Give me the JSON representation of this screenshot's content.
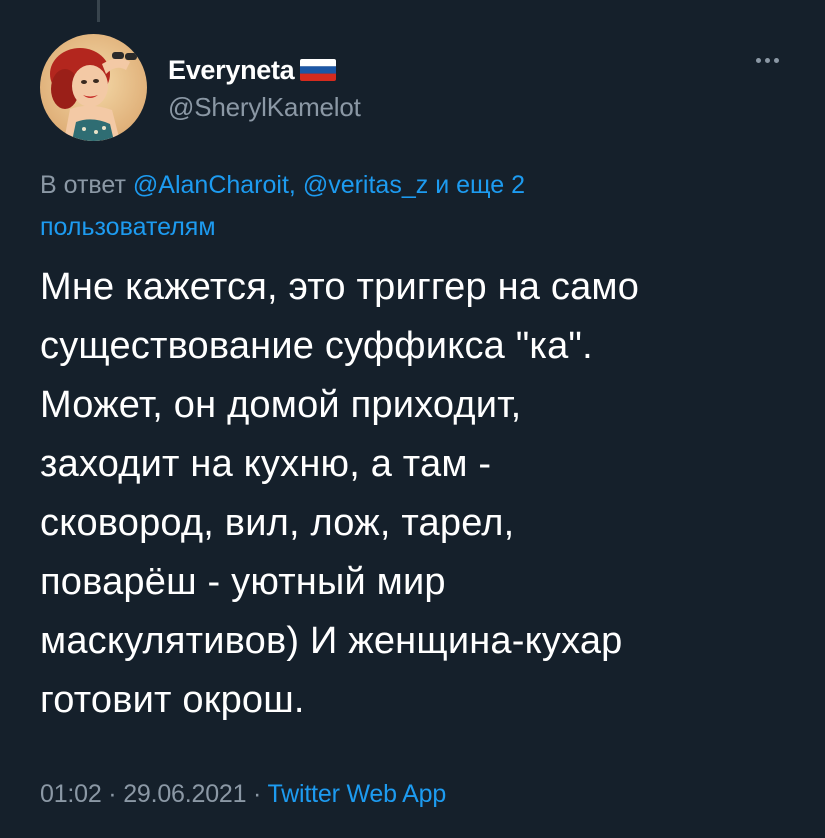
{
  "author": {
    "display_name": "Everyneta",
    "flag_icon": "russia-flag-icon",
    "handle": "@SherylKamelot",
    "avatar_icon": "pinup-girl-avatar"
  },
  "more_icon": "more-options-icon",
  "reply": {
    "prefix": "В ответ ",
    "mention_1": "@AlanCharoit",
    "separator": ", ",
    "mention_2": "@veritas_z",
    "connector": " и ",
    "others": "еще 2 пользователям"
  },
  "tweet": {
    "text": "Мне кажется, это триггер на само\nсуществование суффикса \"ка\".\nМожет, он домой приходит,\nзаходит на кухню, а там  -\nсковород, вил, лож, тарел,\nповарёш - уютный мир\nмаскулятивов) И женщина-кухар\nготовит окрош."
  },
  "meta": {
    "time": "01:02",
    "dot_1": " · ",
    "date": "29.06.2021",
    "dot_2": " · ",
    "source": "Twitter Web App"
  },
  "colors": {
    "background": "#15202b",
    "link": "#1d9bf0",
    "secondary_text": "#8b98a5",
    "primary_text": "#ffffff"
  }
}
